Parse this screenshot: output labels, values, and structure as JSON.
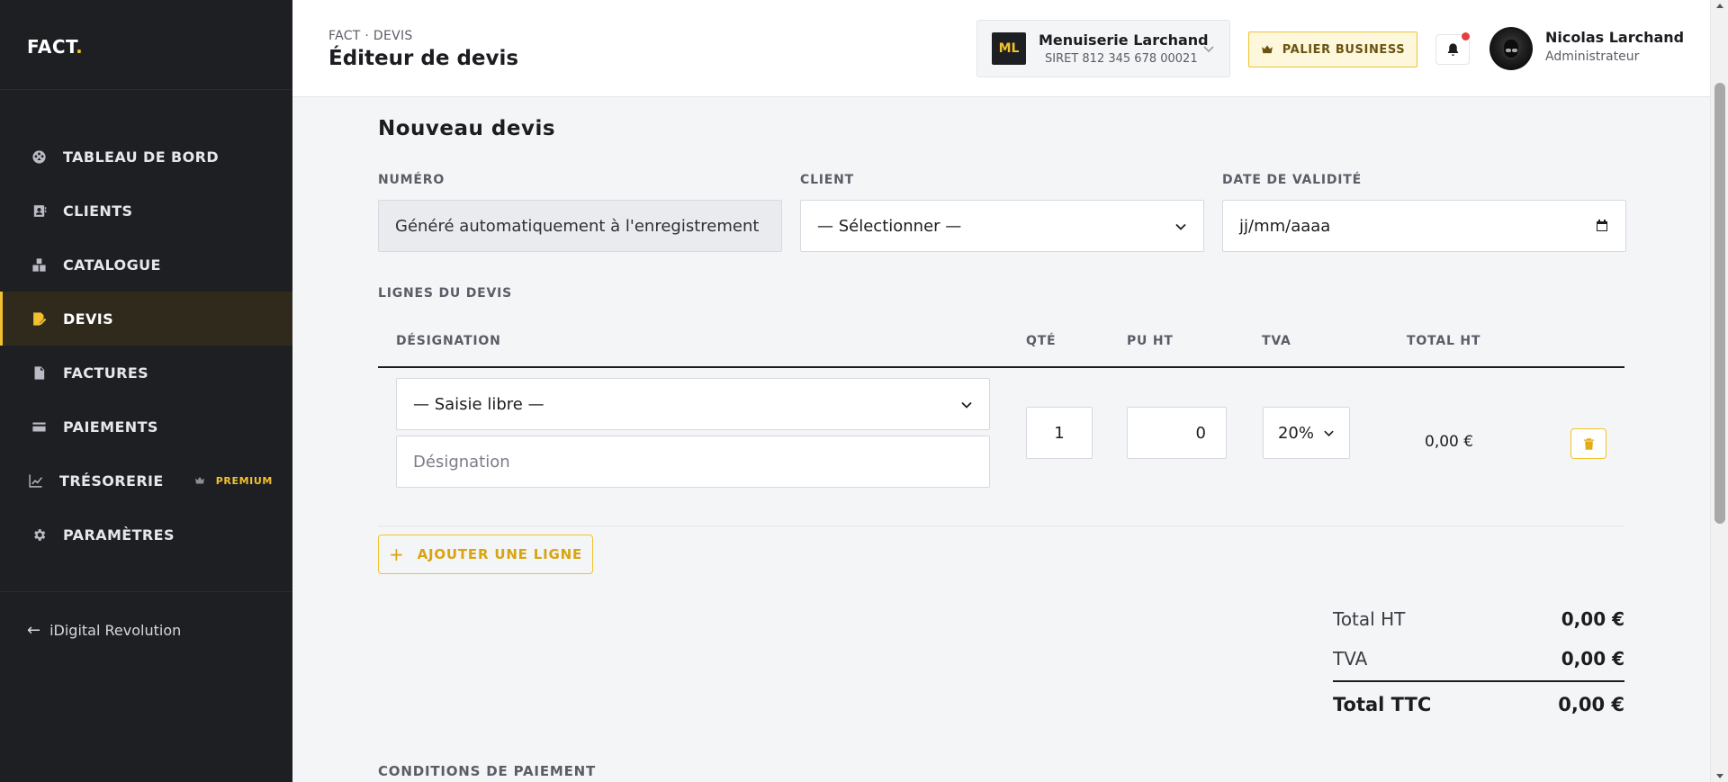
{
  "sidebar": {
    "logo_text": "FACT",
    "logo_dot": ".",
    "items": [
      {
        "label": "TABLEAU DE BORD",
        "icon": "dashboard-icon"
      },
      {
        "label": "CLIENTS",
        "icon": "clients-icon"
      },
      {
        "label": "CATALOGUE",
        "icon": "catalogue-icon"
      },
      {
        "label": "DEVIS",
        "icon": "devis-icon",
        "active": true
      },
      {
        "label": "FACTURES",
        "icon": "factures-icon"
      },
      {
        "label": "PAIEMENTS",
        "icon": "card-icon"
      },
      {
        "label": "TRÉSORERIE",
        "icon": "chart-line-icon",
        "badge": "PREMIUM"
      },
      {
        "label": "PARAMÈTRES",
        "icon": "gear-icon"
      }
    ],
    "back_link": "iDigital Revolution",
    "accent_color": "#f2c12e"
  },
  "header": {
    "breadcrumb": "FACT · DEVIS",
    "title": "Éditeur de devis",
    "company": {
      "initials": "ML",
      "name": "Menuiserie Larchand",
      "siret": "SIRET 812 345 678 00021"
    },
    "tier_button": "PALIER BUSINESS",
    "user": {
      "name": "Nicolas Larchand",
      "role": "Administrateur"
    }
  },
  "form": {
    "title": "Nouveau devis",
    "numero_label": "NUMÉRO",
    "numero_value": "Généré automatiquement à l'enregistrement",
    "client_label": "CLIENT",
    "client_value": "— Sélectionner —",
    "date_label": "DATE DE VALIDITÉ",
    "date_placeholder": "jj/mm/aaaa",
    "lines_label": "LIGNES DU DEVIS",
    "columns": [
      "DÉSIGNATION",
      "QTÉ",
      "PU HT",
      "TVA",
      "TOTAL HT"
    ],
    "line": {
      "product_select": "— Saisie libre —",
      "designation_placeholder": "Désignation",
      "qty": "1",
      "pu_ht": "0",
      "tva": "20%",
      "total_ht": "0,00 €"
    },
    "add_line_button": "AJOUTER UNE LIGNE",
    "totals": {
      "ht_label": "Total HT",
      "ht_value": "0,00 €",
      "tva_label": "TVA",
      "tva_value": "0,00 €",
      "ttc_label": "Total TTC",
      "ttc_value": "0,00 €"
    },
    "payment_conditions_label": "CONDITIONS DE PAIEMENT"
  }
}
